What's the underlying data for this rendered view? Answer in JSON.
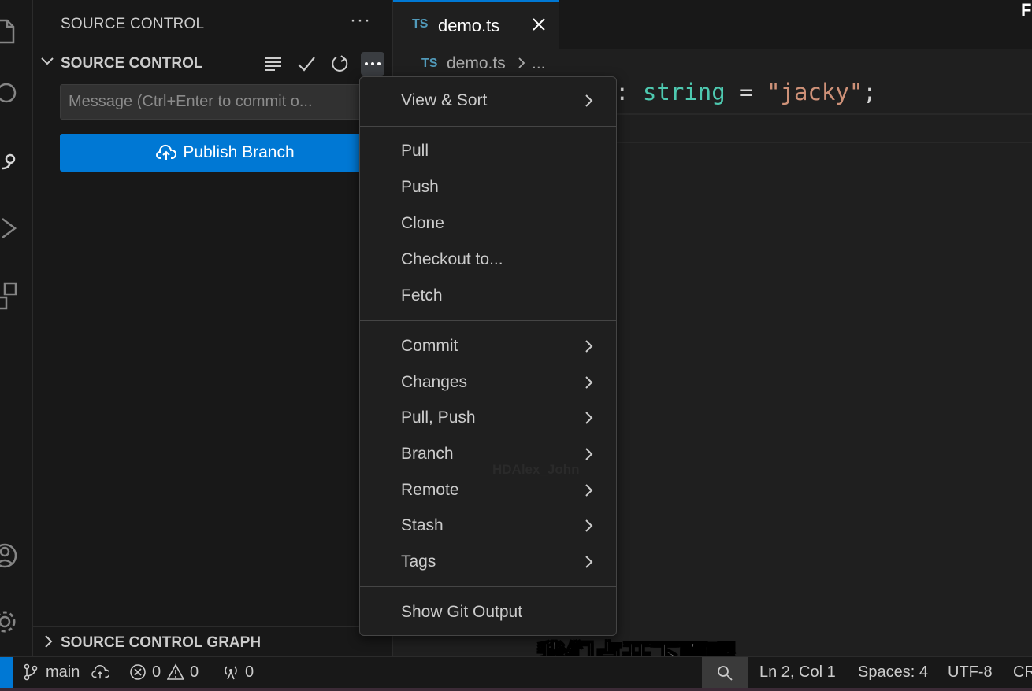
{
  "sidebar": {
    "title": "SOURCE CONTROL",
    "more": "···",
    "section_label": "SOURCE CONTROL",
    "commit_placeholder": "Message (Ctrl+Enter to commit o...",
    "publish_label": "Publish Branch",
    "graph_label": "SOURCE CONTROL GRAPH"
  },
  "editor": {
    "tab_badge": "TS",
    "tab_name": "demo.ts",
    "breadcrumb_badge": "TS",
    "breadcrumb_file": "demo.ts",
    "breadcrumb_more": "...",
    "code": {
      "colon": ": ",
      "type": "string",
      "equals": " = ",
      "string": "\"jacky\"",
      "semi": ";"
    },
    "corner_glyph": "F"
  },
  "menu": {
    "items": [
      {
        "label": "View & Sort",
        "submenu": true
      },
      {
        "label": "Pull",
        "submenu": false
      },
      {
        "label": "Push",
        "submenu": false
      },
      {
        "label": "Clone",
        "submenu": false
      },
      {
        "label": "Checkout to...",
        "submenu": false
      },
      {
        "label": "Fetch",
        "submenu": false
      },
      {
        "label": "Commit",
        "submenu": true
      },
      {
        "label": "Changes",
        "submenu": true
      },
      {
        "label": "Pull, Push",
        "submenu": true
      },
      {
        "label": "Branch",
        "submenu": true
      },
      {
        "label": "Remote",
        "submenu": true
      },
      {
        "label": "Stash",
        "submenu": true
      },
      {
        "label": "Tags",
        "submenu": true
      },
      {
        "label": "Show Git Output",
        "submenu": false
      }
    ],
    "watermark": "HDAlex_John"
  },
  "subtitle": "我们点开下面呢",
  "statusbar": {
    "branch": "main",
    "errors": "0",
    "warnings": "0",
    "ports": "0",
    "position": "Ln 2, Col 1",
    "spaces": "Spaces: 4",
    "encoding": "UTF-8",
    "eol": "CR"
  },
  "colors": {
    "accent": "#0078d4",
    "type_token": "#4ec9b0",
    "string_token": "#ce9178",
    "ts_badge": "#519aba"
  }
}
